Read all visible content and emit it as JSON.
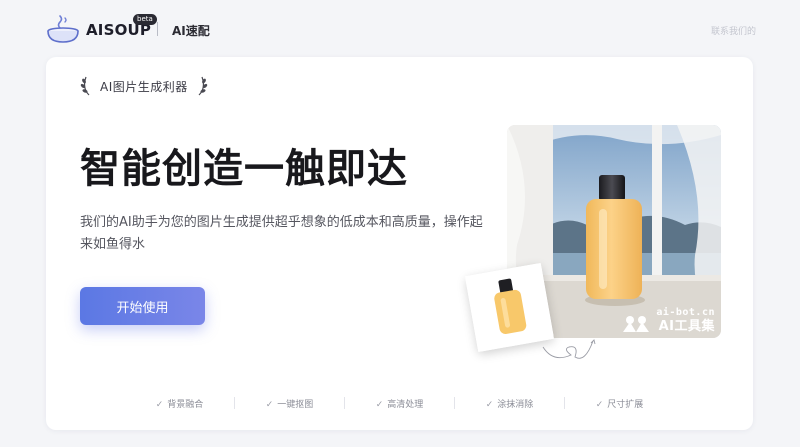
{
  "header": {
    "brand": "AISOUP",
    "beta": "beta",
    "sub_brand": "AI速配",
    "top_right": "联系我们的"
  },
  "hero": {
    "tagline": "AI图片生成利器",
    "headline": "智能创造一触即达",
    "description": "我们的AI助手为您的图片生成提供超乎想象的低成本和高质量，操作起来如鱼得水",
    "cta": "开始使用"
  },
  "image": {
    "watermark_url": "ai-bot.cn",
    "watermark_name": "AI工具集"
  },
  "features": [
    {
      "label": "背景融合"
    },
    {
      "label": "一键抠图"
    },
    {
      "label": "高清处理"
    },
    {
      "label": "涂抹消除"
    },
    {
      "label": "尺寸扩展"
    }
  ],
  "icons": {
    "logo": "soup-bowl-logo-icon",
    "laurel": "laurel-icon",
    "check": "check-icon"
  },
  "colors": {
    "cta_gradient_start": "#5b78e4",
    "cta_gradient_end": "#7a86e8",
    "product_bottle": "#f8c86a"
  }
}
